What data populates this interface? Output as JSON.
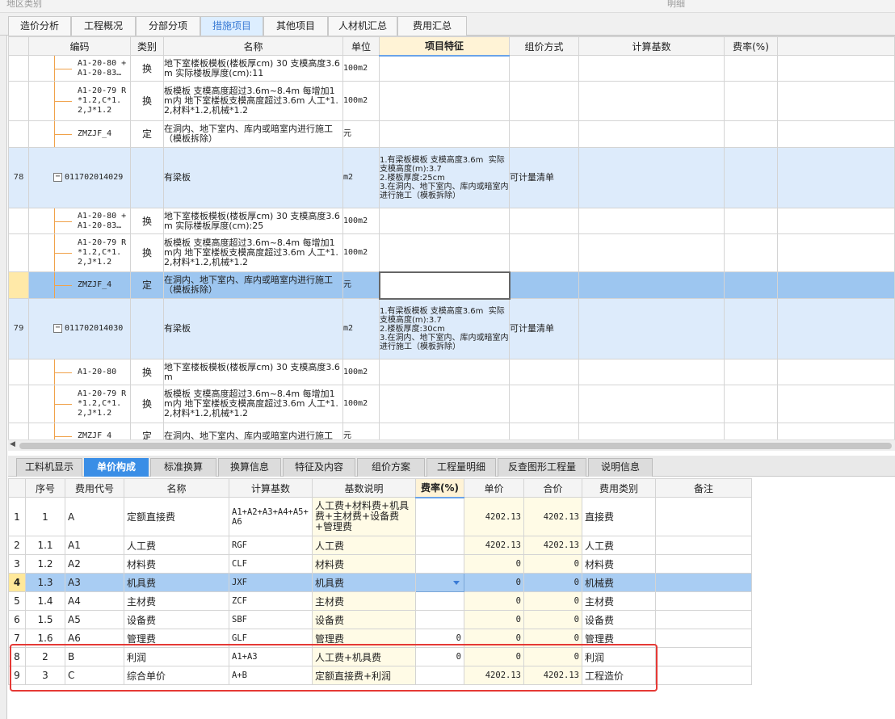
{
  "top_strip": {
    "left": "地区类别",
    "right": "明细"
  },
  "main_tabs": [
    "造价分析",
    "工程概况",
    "分部分项",
    "措施项目",
    "其他项目",
    "人材机汇总",
    "费用汇总"
  ],
  "upper_grid": {
    "columns": [
      "编码",
      "类别",
      "名称",
      "单位",
      "项目特征",
      "组价方式",
      "计算基数",
      "费率(%)"
    ],
    "rows": [
      {
        "no": "",
        "code": "A1-20-80 + A1-20-83…",
        "cat": "换",
        "name": "地下室楼板模板(楼板厚cm) 30 支模高度3.6m  实际楼板厚度(cm):11",
        "unit": "100m2",
        "feature": "",
        "method": ""
      },
      {
        "no": "",
        "code": "A1-20-79 R*1.2,C*1.2,J*1.2",
        "cat": "换",
        "name": "板模板 支模高度超过3.6m~8.4m 每增加1m内  地下室楼板支模高度超过3.6m 人工*1.2,材料*1.2,机械*1.2",
        "unit": "100m2",
        "feature": "",
        "method": ""
      },
      {
        "no": "",
        "code": "ZMZJF_4",
        "cat": "定",
        "name": "在洞内、地下室内、库内或暗室内进行施工（模板拆除）",
        "unit": "元",
        "feature": "",
        "method": ""
      },
      {
        "no": "78",
        "code": "011702014029",
        "cat": "",
        "name": "有梁板",
        "unit": "m2",
        "feature": "1.有梁板模板 支模高度3.6m  实际支模高度(m):3.7\n2.楼板厚度:25cm\n3.在洞内、地下室内、库内或暗室内进行施工（模板拆除）",
        "method": "可计量清单"
      },
      {
        "no": "",
        "code": "A1-20-80 + A1-20-83…",
        "cat": "换",
        "name": "地下室楼板模板(楼板厚cm) 30 支模高度3.6m  实际楼板厚度(cm):25",
        "unit": "100m2",
        "feature": "",
        "method": ""
      },
      {
        "no": "",
        "code": "A1-20-79 R*1.2,C*1.2,J*1.2",
        "cat": "换",
        "name": "板模板 支模高度超过3.6m~8.4m 每增加1m内  地下室楼板支模高度超过3.6m 人工*1.2,材料*1.2,机械*1.2",
        "unit": "100m2",
        "feature": "",
        "method": ""
      },
      {
        "no": "",
        "code": "ZMZJF_4",
        "cat": "定",
        "name": "在洞内、地下室内、库内或暗室内进行施工（模板拆除）",
        "unit": "元",
        "feature": "",
        "method": ""
      },
      {
        "no": "79",
        "code": "011702014030",
        "cat": "",
        "name": "有梁板",
        "unit": "m2",
        "feature": "1.有梁板模板 支模高度3.6m  实际支模高度(m):3.7\n2.楼板厚度:30cm\n3.在洞内、地下室内、库内或暗室内进行施工（模板拆除）",
        "method": "可计量清单"
      },
      {
        "no": "",
        "code": "A1-20-80",
        "cat": "换",
        "name": "地下室楼板模板(楼板厚cm) 30 支模高度3.6m",
        "unit": "100m2",
        "feature": "",
        "method": ""
      },
      {
        "no": "",
        "code": "A1-20-79 R*1.2,C*1.2,J*1.2",
        "cat": "换",
        "name": "板模板 支模高度超过3.6m~8.4m 每增加1m内  地下室楼板支模高度超过3.6m 人工*1.2,材料*1.2,机械*1.2",
        "unit": "100m2",
        "feature": "",
        "method": ""
      },
      {
        "no": "",
        "code": "ZMZJF_4",
        "cat": "定",
        "name": "在洞内、地下室内、库内或暗室内进行施工",
        "unit": "元",
        "feature": "",
        "method": ""
      }
    ]
  },
  "bottom_tabs": [
    "工料机显示",
    "单价构成",
    "标准换算",
    "换算信息",
    "特征及内容",
    "组价方案",
    "工程量明细",
    "反查图形工程量",
    "说明信息"
  ],
  "lower_grid": {
    "columns": [
      "序号",
      "费用代号",
      "名称",
      "计算基数",
      "基数说明",
      "费率(%)",
      "单价",
      "合价",
      "费用类别",
      "备注"
    ],
    "rows": [
      {
        "rn": "1",
        "seq": "1",
        "code": "A",
        "name": "定额直接费",
        "base": "A1+A2+A3+A4+A5+A6",
        "desc": "人工费+材料费+机具费+主材费+设备费+管理费",
        "rate": "",
        "price": "4202.13",
        "total": "4202.13",
        "type": "直接费",
        "note": ""
      },
      {
        "rn": "2",
        "seq": "1.1",
        "code": "A1",
        "name": "人工费",
        "base": "RGF",
        "desc": "人工费",
        "rate": "",
        "price": "4202.13",
        "total": "4202.13",
        "type": "人工费",
        "note": ""
      },
      {
        "rn": "3",
        "seq": "1.2",
        "code": "A2",
        "name": "材料费",
        "base": "CLF",
        "desc": "材料费",
        "rate": "",
        "price": "0",
        "total": "0",
        "type": "材料费",
        "note": ""
      },
      {
        "rn": "4",
        "seq": "1.3",
        "code": "A3",
        "name": "机具费",
        "base": "JXF",
        "desc": "机具费",
        "rate": "",
        "price": "0",
        "total": "0",
        "type": "机械费",
        "note": ""
      },
      {
        "rn": "5",
        "seq": "1.4",
        "code": "A4",
        "name": "主材费",
        "base": "ZCF",
        "desc": "主材费",
        "rate": "",
        "price": "0",
        "total": "0",
        "type": "主材费",
        "note": ""
      },
      {
        "rn": "6",
        "seq": "1.5",
        "code": "A5",
        "name": "设备费",
        "base": "SBF",
        "desc": "设备费",
        "rate": "",
        "price": "0",
        "total": "0",
        "type": "设备费",
        "note": ""
      },
      {
        "rn": "7",
        "seq": "1.6",
        "code": "A6",
        "name": "管理费",
        "base": "GLF",
        "desc": "管理费",
        "rate": "0",
        "price": "0",
        "total": "0",
        "type": "管理费",
        "note": ""
      },
      {
        "rn": "8",
        "seq": "2",
        "code": "B",
        "name": "利润",
        "base": "A1+A3",
        "desc": "人工费+机具费",
        "rate": "0",
        "price": "0",
        "total": "0",
        "type": "利润",
        "note": ""
      },
      {
        "rn": "9",
        "seq": "3",
        "code": "C",
        "name": "综合单价",
        "base": "A+B",
        "desc": "定额直接费+利润",
        "rate": "",
        "price": "4202.13",
        "total": "4202.13",
        "type": "工程造价",
        "note": ""
      }
    ]
  },
  "colors": {
    "accent": "#3a8ee6",
    "selected_row": "#9dc6f0",
    "group_row": "#ddebfb",
    "highlight_box": "#e53935",
    "tree_line": "#f0a24a"
  }
}
